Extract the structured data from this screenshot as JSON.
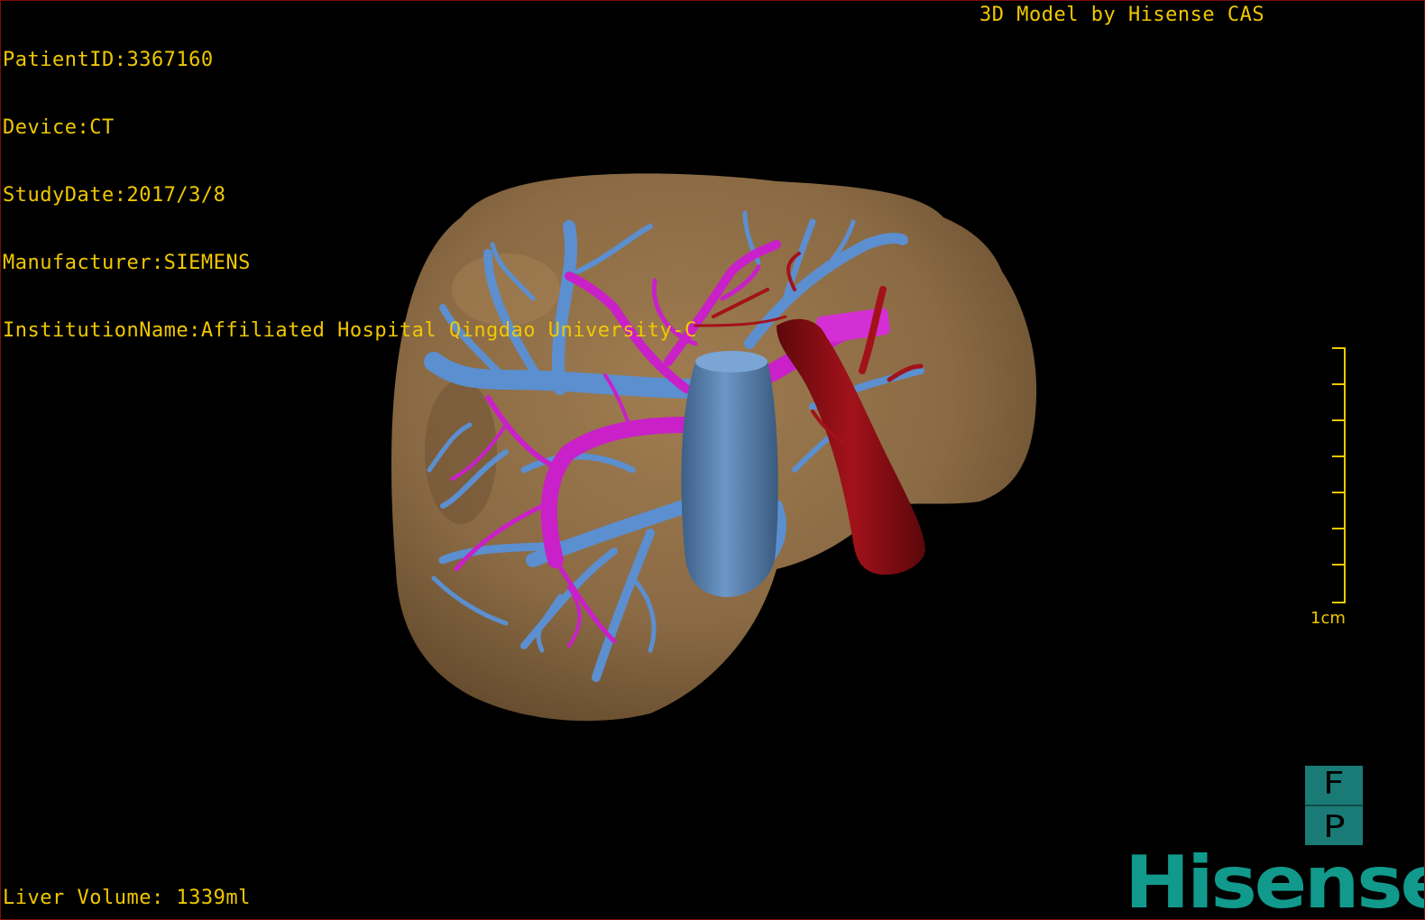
{
  "info": {
    "patient_id": "PatientID:3367160",
    "device": "Device:CT",
    "study_date": "StudyDate:2017/3/8",
    "manufacturer": "Manufacturer:SIEMENS",
    "institution": "InstitutionName:Affiliated Hospital Qingdao University-C"
  },
  "model_credit": "3D Model by Hisense CAS",
  "liver_volume": "Liver Volume: 1339ml",
  "scale_bar": {
    "label": "1cm"
  },
  "orientation": {
    "top_letter": "F",
    "bottom_letter": "P"
  },
  "brand": "Hisense",
  "colors": {
    "overlay_text": "#f0c800",
    "liver": "#8f6d45",
    "portal_vein": "#5b8fd0",
    "hepatic_artery": "#c920c9",
    "ivc": "#9b0f14",
    "brand": "#119a8c"
  }
}
